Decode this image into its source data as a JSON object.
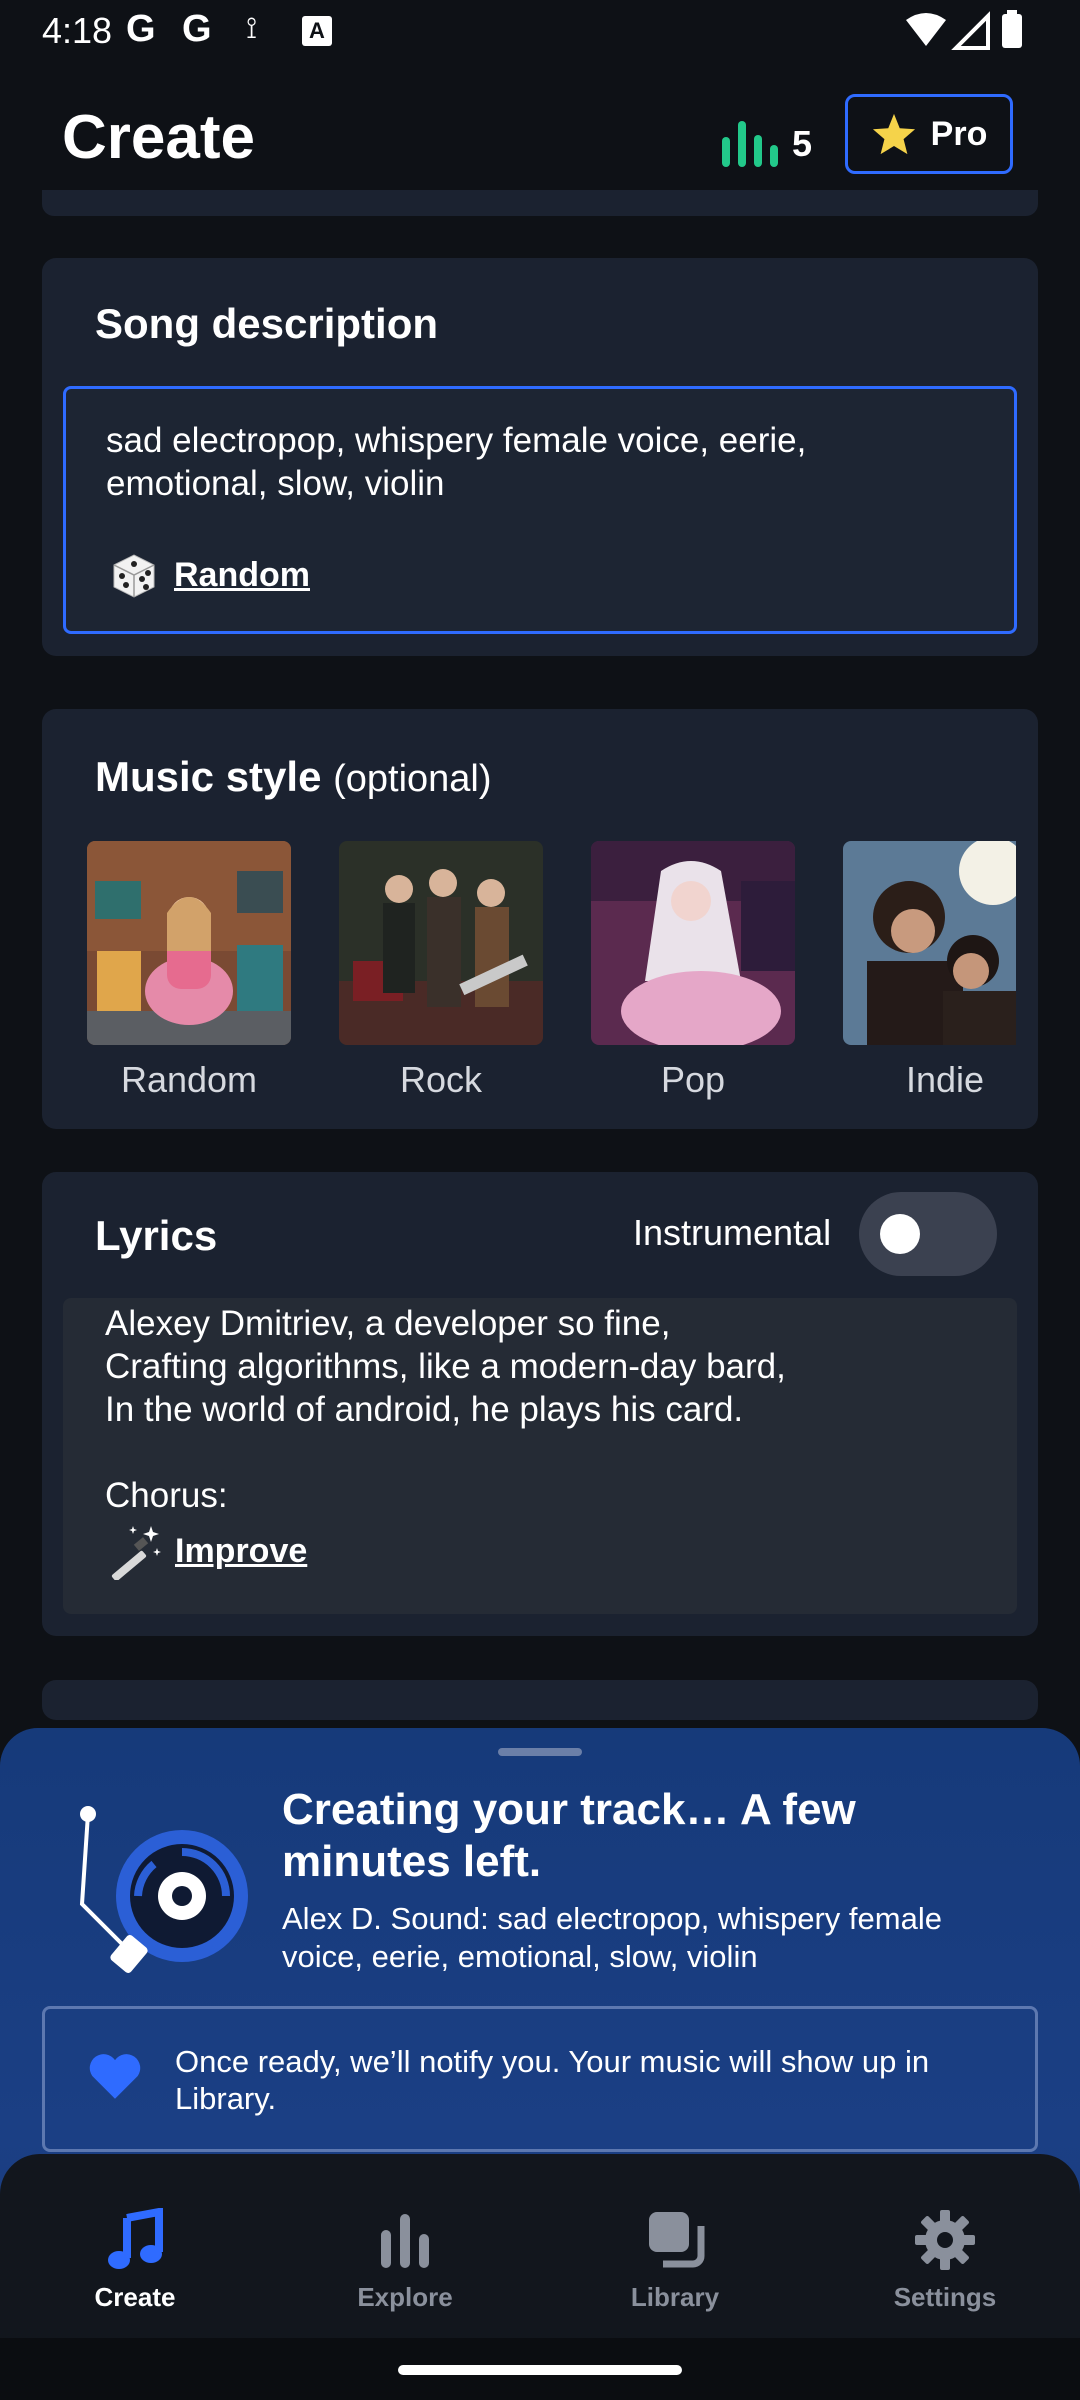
{
  "status_bar": {
    "time": "4:18",
    "icons": [
      "google-icon",
      "google-icon",
      "usb-icon",
      "text-a-icon",
      "wifi-icon",
      "signal-icon",
      "battery-icon"
    ]
  },
  "header": {
    "title": "Create",
    "credits": "5",
    "pro_label": "Pro"
  },
  "song_description": {
    "title": "Song description",
    "text": "sad electropop, whispery female voice, eerie, emotional, slow, violin",
    "random_label": "Random"
  },
  "music_style": {
    "title": "Music style",
    "optional": "(optional)",
    "items": [
      {
        "label": "Random"
      },
      {
        "label": "Rock"
      },
      {
        "label": "Pop"
      },
      {
        "label": "Indie"
      }
    ]
  },
  "lyrics": {
    "title": "Lyrics",
    "instrumental_label": "Instrumental",
    "instrumental_on": false,
    "text": "Alexey Dmitriev, a developer so fine,\nCrafting algorithms, like a modern-day bard,\nIn the world of android, he plays his card.\n\nChorus:",
    "improve_label": "Improve"
  },
  "creating_sheet": {
    "title": "Creating your track… A few minutes left.",
    "subtitle": "Alex D. Sound: sad electropop, whispery female voice, eerie, emotional, slow, violin",
    "notice": "Once ready, we’ll notify you. Your music will show up in Library."
  },
  "bottom_nav": {
    "items": [
      {
        "label": "Create",
        "icon": "music-note-icon",
        "active": true
      },
      {
        "label": "Explore",
        "icon": "bars-icon",
        "active": false
      },
      {
        "label": "Library",
        "icon": "library-icon",
        "active": false
      },
      {
        "label": "Settings",
        "icon": "gear-icon",
        "active": false
      }
    ]
  },
  "colors": {
    "accent": "#2f6bff",
    "credits_green": "#22c98a",
    "background": "#0e1116",
    "card": "#1b2230"
  }
}
